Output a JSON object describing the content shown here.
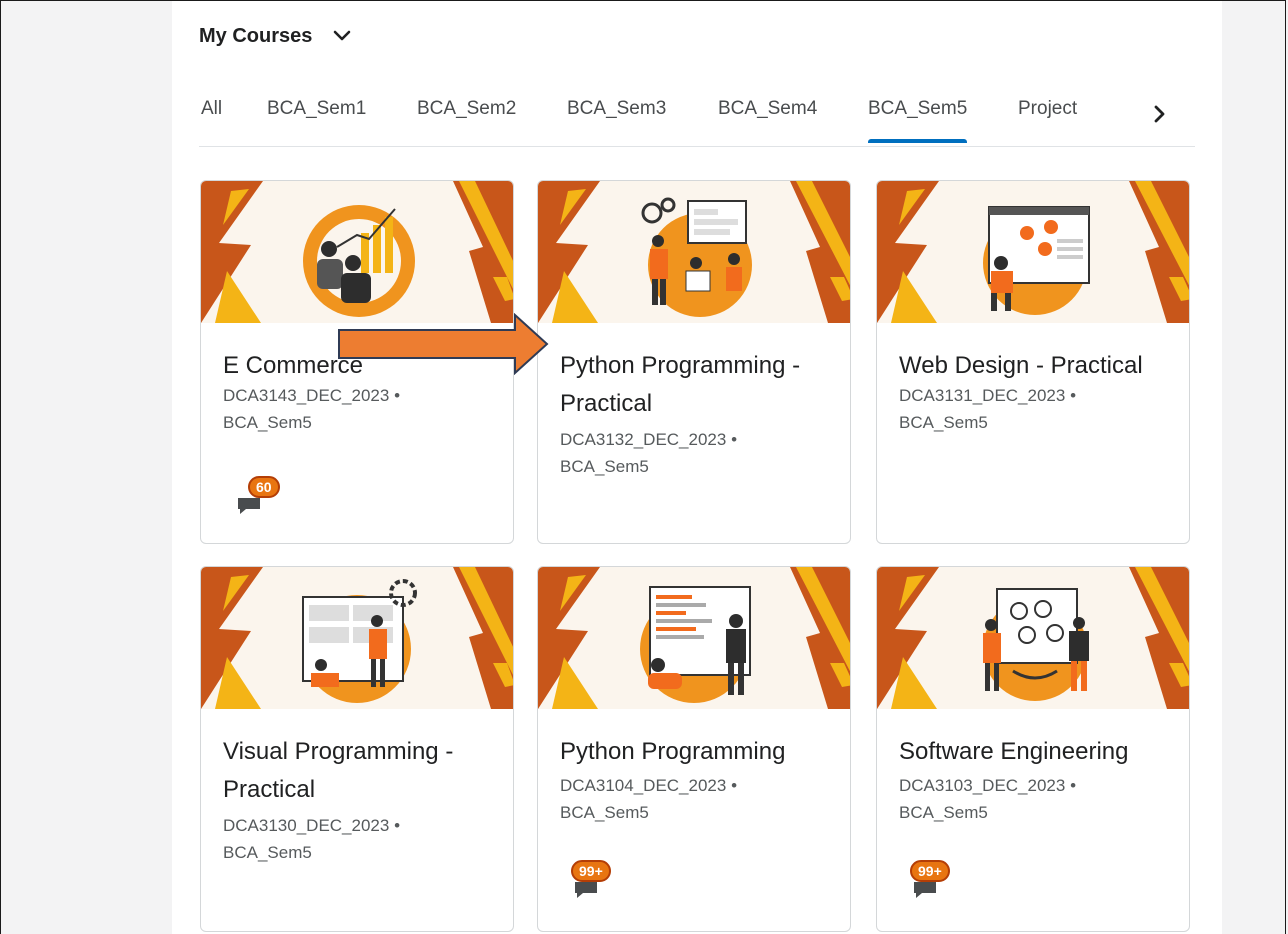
{
  "header": {
    "title": "My Courses",
    "chevron_icon": "chevron-down-icon"
  },
  "tabs": [
    {
      "label": "All",
      "active": false
    },
    {
      "label": "BCA_Sem1",
      "active": false
    },
    {
      "label": "BCA_Sem2",
      "active": false
    },
    {
      "label": "BCA_Sem3",
      "active": false
    },
    {
      "label": "BCA_Sem4",
      "active": false
    },
    {
      "label": "BCA_Sem5",
      "active": true
    },
    {
      "label": "Project",
      "active": false
    }
  ],
  "tab_next_icon": "chevron-right-icon",
  "colors": {
    "accent": "#006fbf",
    "banner_bg": "#fbf5ed",
    "banner_orange": "#c8561a",
    "banner_yellow": "#f4b416",
    "badge": "#e87511",
    "annotation_arrow": "#ed7d31"
  },
  "courses": [
    {
      "title": "E Commerce",
      "code": "DCA3143_DEC_2023",
      "separator": "•",
      "semester": "BCA_Sem5",
      "badge": "60",
      "illustration": "analytics-illustration"
    },
    {
      "title": "Python Programming - Practical",
      "code": "DCA3132_DEC_2023",
      "separator": "•",
      "semester": "BCA_Sem5",
      "badge": "",
      "illustration": "team-workspace-illustration"
    },
    {
      "title": "Web Design - Practical",
      "code": "DCA3131_DEC_2023",
      "separator": "•",
      "semester": "BCA_Sem5",
      "badge": "",
      "illustration": "web-design-illustration"
    },
    {
      "title": "Visual Programming - Practical",
      "code": "DCA3130_DEC_2023",
      "separator": "•",
      "semester": "BCA_Sem5",
      "badge": "",
      "illustration": "visual-programming-illustration"
    },
    {
      "title": "Python Programming",
      "code": "DCA3104_DEC_2023",
      "separator": "•",
      "semester": "BCA_Sem5",
      "badge": "99+",
      "illustration": "coding-screen-illustration"
    },
    {
      "title": "Software Engineering",
      "code": "DCA3103_DEC_2023",
      "separator": "•",
      "semester": "BCA_Sem5",
      "badge": "99+",
      "illustration": "software-engineering-illustration"
    }
  ],
  "annotation": {
    "icon": "arrow-right-icon",
    "color": "#ed7d31"
  }
}
